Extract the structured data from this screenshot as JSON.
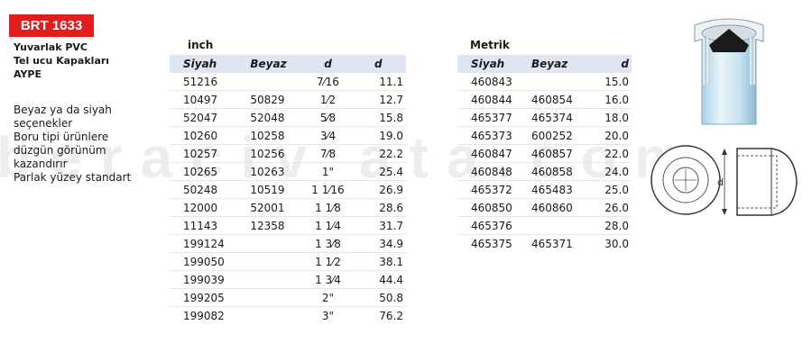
{
  "code": "BRT 1633",
  "title_lines": [
    "Yuvarlak PVC",
    "Tel ucu Kapakları",
    "AYPE"
  ],
  "features": [
    "Beyaz ya da siyah",
    "seçenekler",
    "Boru tipi ürünlere",
    "düzgün görünüm",
    "kazandırır",
    "Parlak yüzey standart"
  ],
  "watermark": "beraciv ata.com",
  "inch": {
    "title": "inch",
    "headers": [
      "Siyah",
      "Beyaz",
      "d",
      "d"
    ],
    "rows": [
      [
        "51216",
        "",
        "7⁄16",
        "11.1"
      ],
      [
        "10497",
        "50829",
        "1⁄2",
        "12.7"
      ],
      [
        "52047",
        "52048",
        "5⁄8",
        "15.8"
      ],
      [
        "10260",
        "10258",
        "3⁄4",
        "19.0"
      ],
      [
        "10257",
        "10256",
        "7⁄8",
        "22.2"
      ],
      [
        "10265",
        "10263",
        "1\"",
        "25.4"
      ],
      [
        "50248",
        "10519",
        "1 1⁄16",
        "26.9"
      ],
      [
        "12000",
        "52001",
        "1 1⁄8",
        "28.6"
      ],
      [
        "11143",
        "12358",
        "1 1⁄4",
        "31.7"
      ],
      [
        "199124",
        "",
        "1 3⁄8",
        "34.9"
      ],
      [
        "199050",
        "",
        "1 1⁄2",
        "38.1"
      ],
      [
        "199039",
        "",
        "1 3⁄4",
        "44.4"
      ],
      [
        "199205",
        "",
        "2\"",
        "50.8"
      ],
      [
        "199082",
        "",
        "3\"",
        "76.2"
      ]
    ]
  },
  "metric": {
    "title": "Metrik",
    "headers": [
      "Siyah",
      "Beyaz",
      "d"
    ],
    "rows": [
      [
        "460843",
        "",
        "15.0"
      ],
      [
        "460844",
        "460854",
        "16.0"
      ],
      [
        "465377",
        "465374",
        "18.0"
      ],
      [
        "465373",
        "600252",
        "20.0"
      ],
      [
        "460847",
        "460857",
        "22.0"
      ],
      [
        "460848",
        "460858",
        "24.0"
      ],
      [
        "465372",
        "465483",
        "25.0"
      ],
      [
        "460850",
        "460860",
        "26.0"
      ],
      [
        "465376",
        "",
        "28.0"
      ],
      [
        "465375",
        "465371",
        "30.0"
      ]
    ]
  },
  "diagram_label": "d",
  "colors": {
    "badge": "#e11d1d",
    "header_bg": "#dfe6f3",
    "tube": "#cfe6f3"
  }
}
